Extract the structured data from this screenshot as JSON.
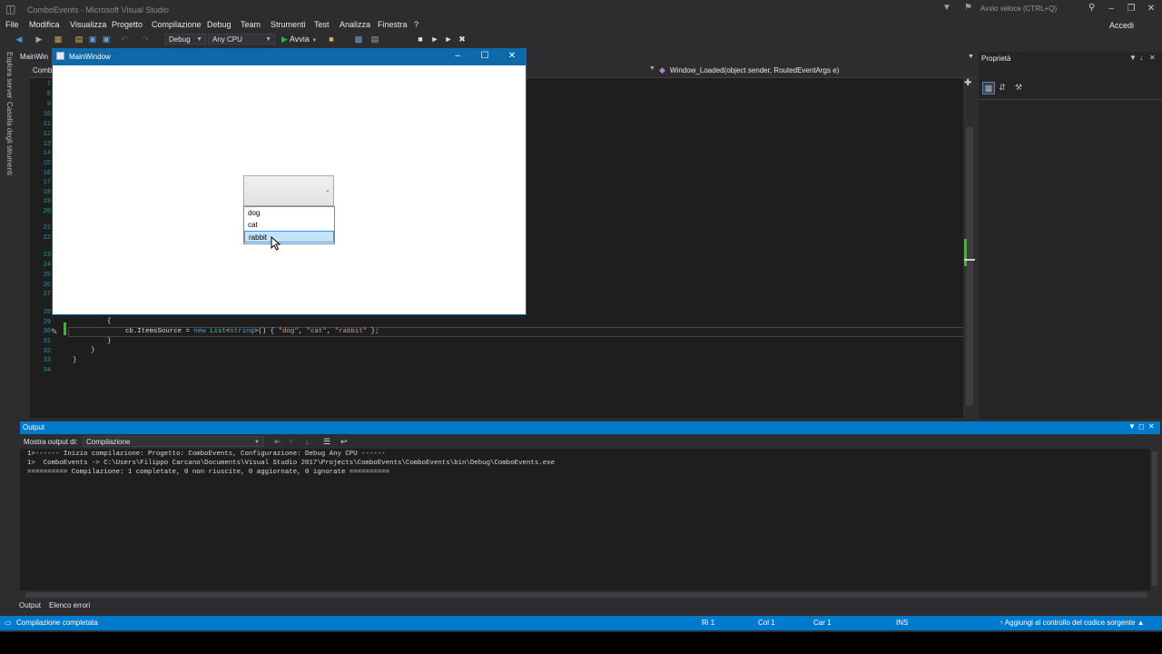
{
  "app": {
    "title": "ComboEvents - Microsoft Visual Studio",
    "quick_launch": "Avvio veloce (CTRL+Q)",
    "sign_in": "Accedi"
  },
  "menu": [
    "File",
    "Modifica",
    "Visualizza",
    "Progetto",
    "Compilazione",
    "Debug",
    "Team",
    "Strumenti",
    "Test",
    "Analizza",
    "Finestra",
    "?"
  ],
  "toolbar": {
    "config": "Debug",
    "platform": "Any CPU",
    "run": "Avvia"
  },
  "side_tabs": [
    "Esplora server",
    "Casella degli strumenti"
  ],
  "editor": {
    "tab_label": "MainWin",
    "tab_label2": "Comb",
    "member_dropdown": "Window_Loaded(object sender, RoutedEventArgs e)",
    "line_numbers": [
      "7",
      "8",
      "9",
      "10",
      "11",
      "12",
      "13",
      "14",
      "15",
      "16",
      "17",
      "18",
      "19",
      "20",
      "21",
      "22",
      "23",
      "24",
      "25",
      "26",
      "27",
      "28",
      "29",
      "30",
      "31",
      "32",
      "33",
      "34"
    ],
    "code": {
      "l29": "{",
      "l30_a": "cb.ItemsSource = ",
      "l30_new": "new",
      "l30_list": "List",
      "l30_lt": "<",
      "l30_string": "string",
      "l30_mid": ">() { ",
      "l30_dog": "\"dog\"",
      "l30_c1": ", ",
      "l30_cat": "\"cat\"",
      "l30_c2": ", ",
      "l30_rabbit": "\"rabbit\"",
      "l30_end": " };",
      "l31": "}",
      "l32": "}",
      "l33": "}"
    }
  },
  "properties": {
    "title": "Proprietà"
  },
  "wpf_window": {
    "title": "MainWindow",
    "combo_items": [
      "dog",
      "cat",
      "rabbit"
    ],
    "highlighted_index": 2
  },
  "output": {
    "title": "Output",
    "show_from_label": "Mostra output di:",
    "show_from_value": "Compilazione",
    "lines": [
      "1>------ Inizio compilazione: Progetto: ComboEvents, Configurazione: Debug Any CPU ------",
      "1>  ComboEvents -> C:\\Users\\Filippo Carcano\\Documents\\Visual Studio 2017\\Projects\\ComboEvents\\ComboEvents\\bin\\Debug\\ComboEvents.exe",
      "========== Compilazione: 1 completate, 0 non riuscite, 0 aggiornate, 0 ignorate =========="
    ]
  },
  "bottom_tabs": [
    "Output",
    "Elenco errori"
  ],
  "status_bar": {
    "message": "Compilazione completata",
    "line": "Ri 1",
    "col": "Col 1",
    "char": "Car 1",
    "mode": "INS",
    "source_control": "Aggiungi al controllo del codice sorgente"
  },
  "colors": {
    "accent": "#007acc",
    "editor_bg": "#1e1e1e",
    "chrome_bg": "#2d2d30",
    "wpf_titlebar": "#0f69a8",
    "highlight": "#c5e3f7"
  }
}
